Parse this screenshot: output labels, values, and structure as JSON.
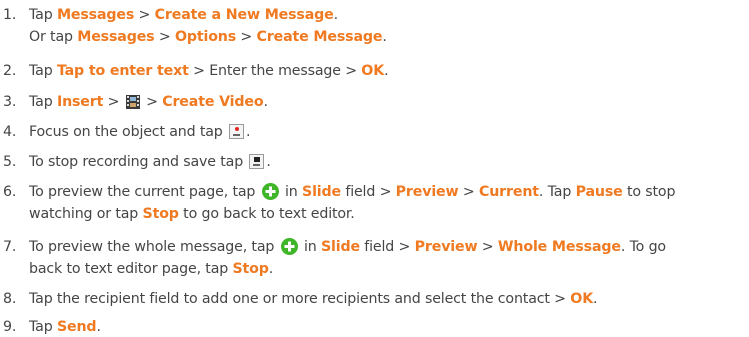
{
  "steps": [
    {
      "number": "1.",
      "line1": {
        "t1": "Tap ",
        "hl1": "Messages",
        "t2": " > ",
        "hl2": "Create a New Message",
        "t3": "."
      },
      "line2": {
        "t1": "Or tap ",
        "hl1": "Messages",
        "t2": " > ",
        "hl2": "Options",
        "t3": " > ",
        "hl3": "Create Message",
        "t4": "."
      }
    },
    {
      "number": "2.",
      "t1": "Tap ",
      "hl1": "Tap to enter text",
      "t2": " > Enter the message > ",
      "hl2": "OK",
      "t3": "."
    },
    {
      "number": "3.",
      "t1": "Tap ",
      "hl1": "Insert",
      "t2": " > ",
      "icon": "video-clip-icon",
      "t3": " > ",
      "hl2": "Create Video",
      "t4": "."
    },
    {
      "number": "4.",
      "t1": "Focus on the object and tap ",
      "icon": "record-icon",
      "icon_text": "REC",
      "t2": "."
    },
    {
      "number": "5.",
      "t1": "To stop recording and save tap ",
      "icon": "stop-icon",
      "icon_text": "STOP",
      "t2": "."
    },
    {
      "number": "6.",
      "line1": {
        "t1": "To preview the current page, tap ",
        "icon": "plus-circle-icon",
        "t2": " in ",
        "hl1": "Slide",
        "t3": " field > ",
        "hl2": "Preview",
        "t4": " > ",
        "hl3": "Current",
        "t5": ". Tap ",
        "hl4": "Pause",
        "t6": " to stop"
      },
      "line2": {
        "t1": "watching or tap ",
        "hl1": "Stop",
        "t2": " to go back to text editor."
      }
    },
    {
      "number": "7.",
      "line1": {
        "t1": "To preview the whole message, tap ",
        "icon": "plus-circle-icon",
        "t2": " in ",
        "hl1": "Slide",
        "t3": " field > ",
        "hl2": "Preview",
        "t4": " > ",
        "hl3": "Whole Message",
        "t5": ". To go"
      },
      "line2": {
        "t1": "back to text editor page, tap ",
        "hl1": "Stop",
        "t2": "."
      }
    },
    {
      "number": "8.",
      "t1": "Tap the recipient field to add one or more recipients and select the contact > ",
      "hl1": "OK",
      "t2": "."
    },
    {
      "number": "9.",
      "t1": "Tap ",
      "hl1": "Send",
      "t2": "."
    }
  ],
  "colors": {
    "text": "#454545",
    "highlight": "#ef7a21",
    "plus_icon": "#3fb528"
  }
}
